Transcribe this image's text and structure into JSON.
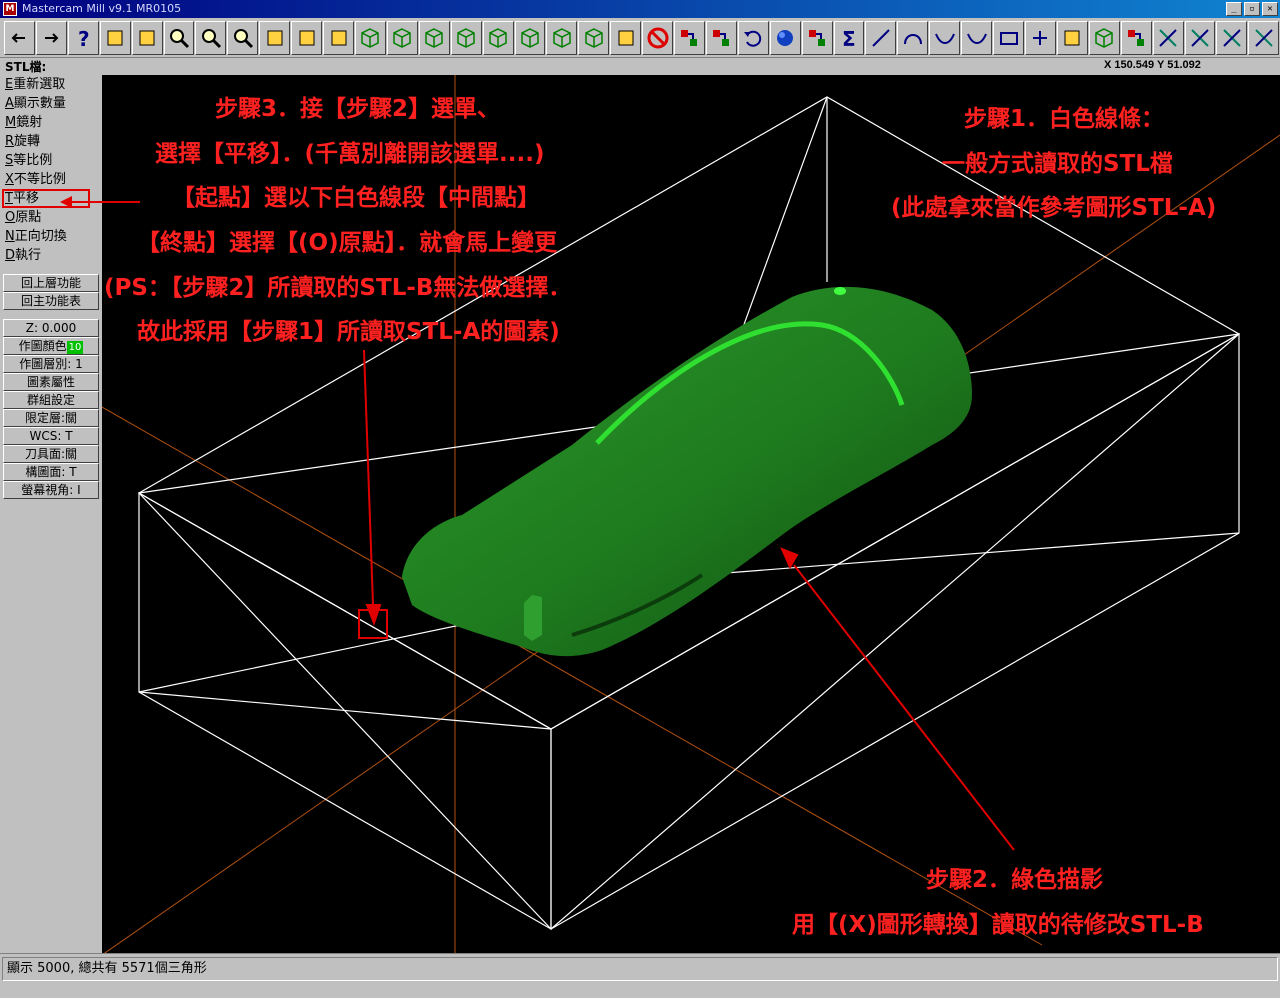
{
  "window": {
    "app_icon": "M",
    "title": "Mastercam Mill v9.1 MR0105",
    "buttons": [
      "_",
      "▫",
      "✕"
    ]
  },
  "toolbar": {
    "icons": [
      "back-arrow-icon",
      "forward-arrow-icon",
      "help-icon",
      "calculator-icon",
      "analyze-icon",
      "zoom-in-icon",
      "zoom-fit-icon",
      "zoom-window-icon",
      "pan-icon",
      "select-icon",
      "rotate-icon",
      "top-view-icon",
      "front-view-icon",
      "side-view-icon",
      "iso-view-icon",
      "cube-view-1-icon",
      "cube-view-2-icon",
      "cube-view-3-icon",
      "cube-view-4-icon",
      "pencil-icon",
      "no-entry-icon",
      "transfer-1-icon",
      "transfer-2-icon",
      "undo-icon",
      "sphere-icon",
      "layers-icon",
      "sigma-icon",
      "line-icon",
      "arc-icon",
      "curve-down-icon",
      "spline-icon",
      "rectangle-icon",
      "point-plus-icon",
      "surface-icon",
      "solid-box-icon",
      "levels-icon",
      "trim-1-icon",
      "trim-2-icon",
      "trim-3-icon",
      "trim-4-icon"
    ]
  },
  "status": {
    "prompt": "STL檔:",
    "coords": "X 150.549   Y 51.092"
  },
  "menu": {
    "items": [
      {
        "key": "E",
        "label": "重新選取"
      },
      {
        "key": "A",
        "label": "顯示數量"
      },
      {
        "key": "M",
        "label": "鏡射"
      },
      {
        "key": "R",
        "label": "旋轉"
      },
      {
        "key": "S",
        "label": "等比例"
      },
      {
        "key": "X",
        "label": "不等比例"
      },
      {
        "key": "T",
        "label": "平移"
      },
      {
        "key": "O",
        "label": "原點"
      },
      {
        "key": "N",
        "label": "正向切換"
      },
      {
        "key": "D",
        "label": "執行"
      }
    ],
    "back_up": "回上層功能",
    "main_menu": "回主功能表",
    "z_label": "Z:  0.000",
    "color_label": "作圖顏色",
    "color_value": "10",
    "level_label": "作圖層別: 1",
    "attributes": "圖素屬性",
    "group": "群組設定",
    "mask": "限定層:關",
    "wcs": "WCS:  T",
    "tool_plane": "刀具面:關",
    "cplane": "構圖面: T",
    "gview": "螢幕視角: I"
  },
  "notes": {
    "step3": [
      "步驟3．接【步驟2】選單、",
      "選擇【平移】．(千萬別離開該選單....)",
      "【起點】選以下白色線段【中間點】",
      "【終點】選擇【(O)原點】．就會馬上變更",
      "(PS：【步驟2】所讀取的STL-B無法做選擇．",
      "故此採用【步驟1】所讀取STL-A的圖素)"
    ],
    "step1": [
      "步驟1．白色線條：",
      "一般方式讀取的STL檔",
      "(此處拿來當作參考圖形STL-A)"
    ],
    "step2": [
      "步驟2．綠色描影",
      "用【(X)圖形轉換】讀取的待修改STL-B"
    ]
  },
  "colors": {
    "annotation": "#ff2020",
    "model": "#1f8f1f",
    "wireframe": "#ffffff",
    "axis": "#b05010"
  },
  "bottom": {
    "message": "顯示 5000, 總共有 5571個三角形"
  }
}
